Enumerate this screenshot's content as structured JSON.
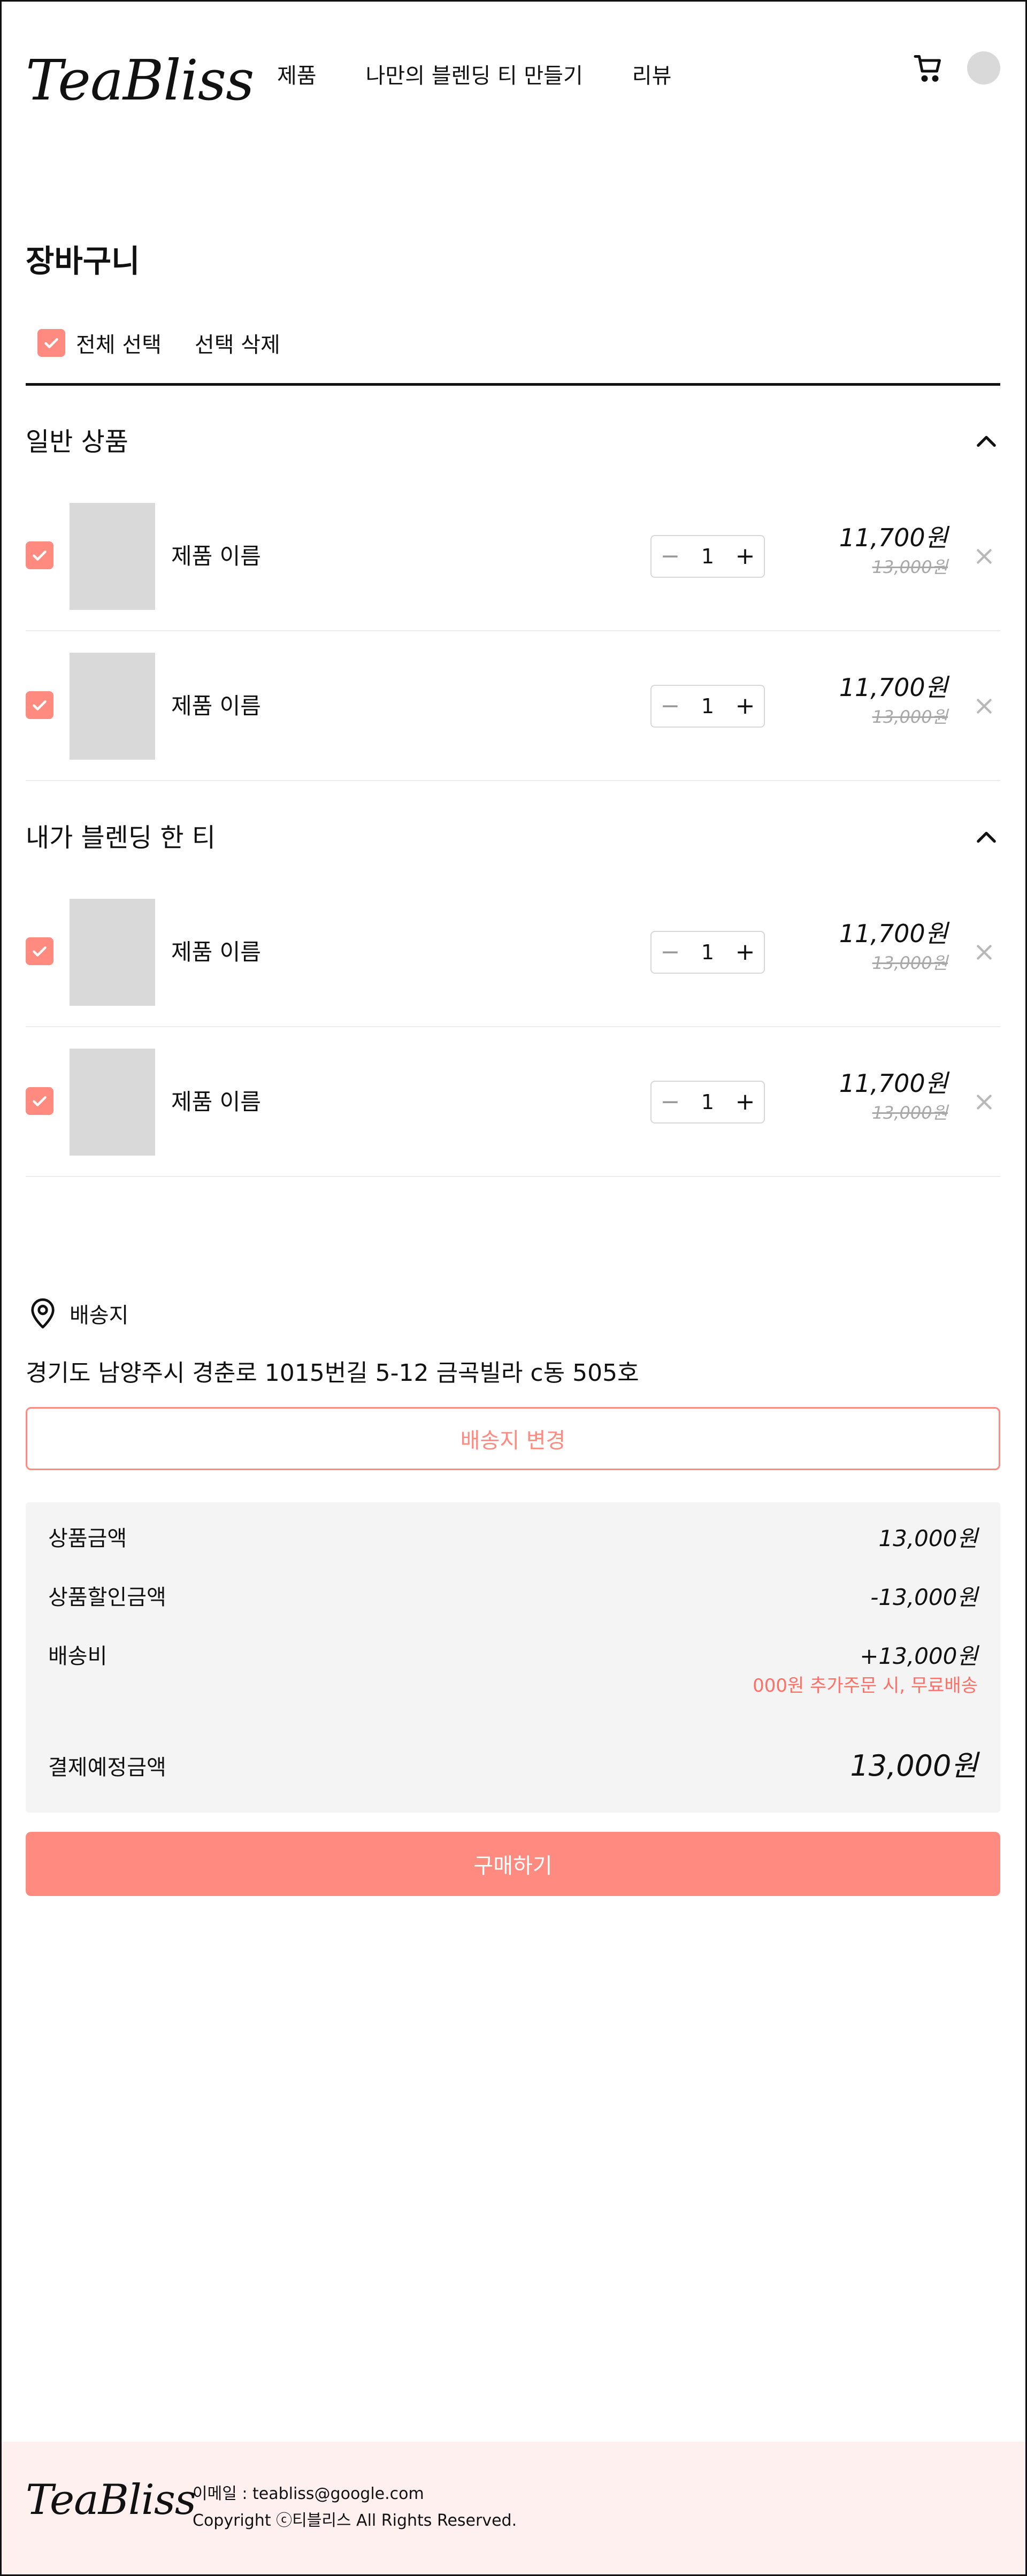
{
  "header": {
    "logo": "TeaBliss",
    "nav": [
      "제품",
      "나만의 블렌딩 티 만들기",
      "리뷰"
    ],
    "icons": [
      "cart-icon",
      "avatar"
    ]
  },
  "cart": {
    "title": "장바구니",
    "select_all_label": "전체 선택",
    "delete_selected_label": "선택 삭제"
  },
  "sections": [
    {
      "title": "일반 상품",
      "items": [
        {
          "name": "제품 이름",
          "qty": "1",
          "price": "11,700원",
          "original_price": "13,000원",
          "checked": true
        },
        {
          "name": "제품 이름",
          "qty": "1",
          "price": "11,700원",
          "original_price": "13,000원",
          "checked": true
        }
      ]
    },
    {
      "title": "내가 블렌딩 한 티",
      "items": [
        {
          "name": "제품 이름",
          "qty": "1",
          "price": "11,700원",
          "original_price": "13,000원",
          "checked": true
        },
        {
          "name": "제품 이름",
          "qty": "1",
          "price": "11,700원",
          "original_price": "13,000원",
          "checked": true
        }
      ]
    }
  ],
  "stepper": {
    "minus": "−",
    "plus": "+"
  },
  "shipping": {
    "label": "배송지",
    "address": "경기도 남양주시 경춘로 1015번길 5-12 금곡빌라 c동 505호",
    "change_button": "배송지 변경"
  },
  "summary": {
    "product_amount_label": "상품금액",
    "product_amount": "13,000원",
    "discount_label": "상품할인금액",
    "discount": "-13,000원",
    "shipping_fee_label": "배송비",
    "shipping_fee": "+13,000원",
    "free_shipping_note": "000원 추가주문 시, 무료배송",
    "total_label": "결제예정금액",
    "total": "13,000원"
  },
  "buy_button": "구매하기",
  "footer": {
    "logo": "TeaBliss",
    "email": "이메일 : teabliss@google.com",
    "copyright": "Copyright ⓒ티블리스 All Rights Reserved."
  },
  "colors": {
    "accent": "#ff8a80",
    "placeholder": "#d9d9d9",
    "summary_bg": "#f4f4f4",
    "footer_bg": "#fff0f0"
  }
}
